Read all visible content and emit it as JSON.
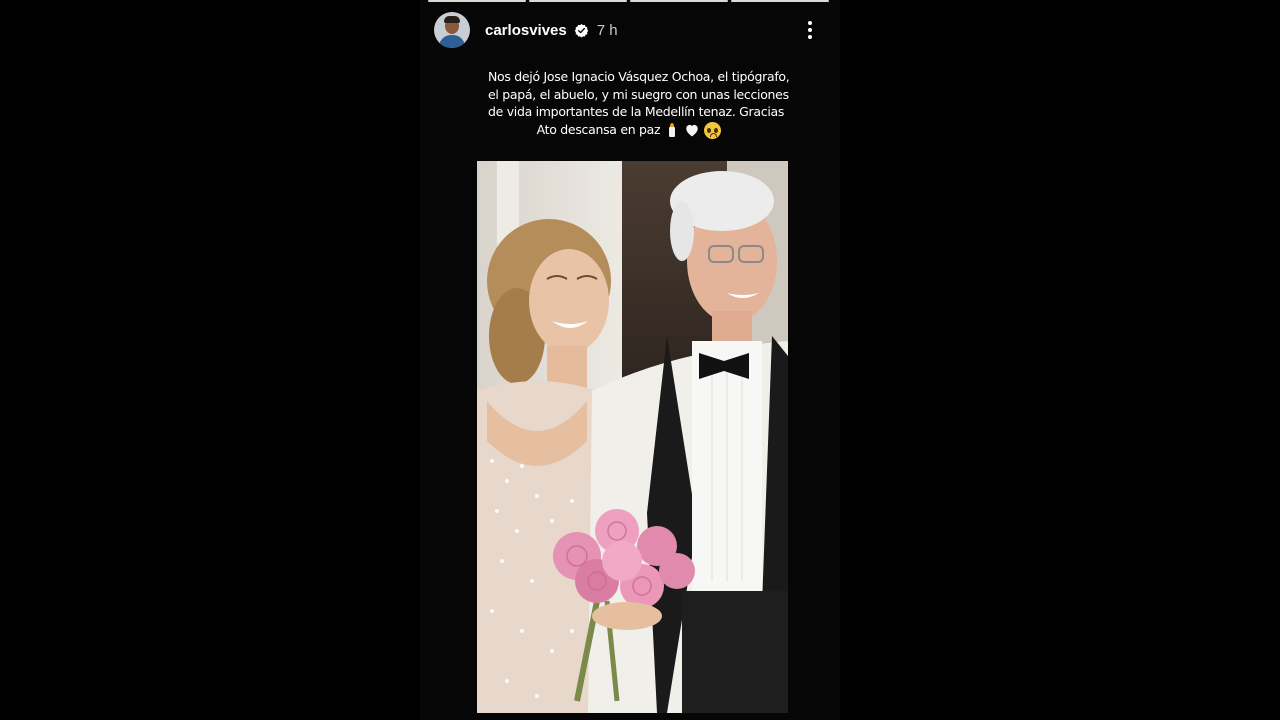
{
  "story": {
    "progress_segments": 4,
    "progress_done": 4,
    "user": {
      "username": "carlosvives",
      "verified": true,
      "time_ago": "7 h",
      "avatar_icon": "profile-avatar"
    },
    "menu_icon": "more-vertical-icon",
    "caption": {
      "lines": [
        "Nos dejó Jose Ignacio Vásquez Ochoa, el tipógrafo,",
        "el papá, el abuelo, y mi suegro con unas lecciones",
        "de vida importantes de la Medellín tenaz. Gracias",
        "Ato descansa en paz"
      ],
      "emojis": [
        "candle",
        "white-heart",
        "pleading-face"
      ]
    },
    "photo": {
      "icon": "story-photo",
      "description_colors": {
        "background": "#e7e3dc",
        "doorway": "#3a3029",
        "suit": "#f1efea",
        "bouquet": "#e58fb0"
      }
    }
  },
  "colors": {
    "background": "#000000",
    "text": "#ffffff",
    "muted_text": "#c8c8c8",
    "verified_badge": "#ffffff"
  }
}
